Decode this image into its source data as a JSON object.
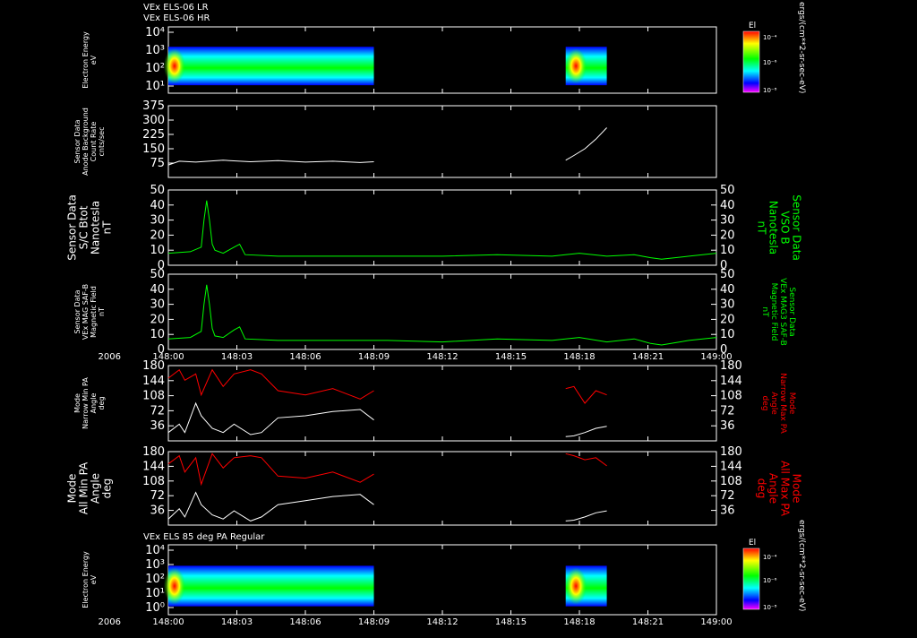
{
  "title_lines": [
    "VEx ELS-06 LR",
    "VEx ELS-06 HR"
  ],
  "bottom_panel_title": "VEx ELS 85 deg PA Regular",
  "year_label": "2006",
  "time_ticks": [
    "148:00",
    "148:03",
    "148:06",
    "148:09",
    "148:12",
    "148:15",
    "148:18",
    "148:21",
    "149:00"
  ],
  "colorbar": {
    "title": "El",
    "ticks": [
      "10⁻⁴",
      "10⁻⁶",
      "10⁻⁸"
    ],
    "units": "ergs/(cm**2-sr-sec-eV)"
  },
  "colors": {
    "white": "#ffffff",
    "green": "#00ff00",
    "red": "#ff0000",
    "black": "#000000"
  },
  "chart_data": [
    {
      "type": "heatmap",
      "id": "spectrogram-top",
      "ylabel": [
        "Electron Energy",
        "eV"
      ],
      "yticks": [
        "10⁴",
        "10³",
        "10²",
        "10¹"
      ],
      "scale": "log",
      "data_intervals": [
        [
          0.0,
          0.375
        ],
        [
          0.725,
          0.8
        ]
      ]
    },
    {
      "type": "line",
      "id": "count-rate",
      "ylabel": [
        "Sensor Data",
        "Anode Background",
        "Count Rate",
        "cnts/sec"
      ],
      "yticks": [
        "375",
        "300",
        "225",
        "150",
        "75"
      ],
      "ylim": [
        0,
        375
      ],
      "series": [
        {
          "color": "#ffffff",
          "x": [
            0.0,
            0.02,
            0.05,
            0.1,
            0.15,
            0.2,
            0.25,
            0.3,
            0.35,
            0.375
          ],
          "y": [
            65,
            85,
            80,
            90,
            82,
            88,
            80,
            85,
            78,
            82
          ]
        },
        {
          "color": "#ffffff",
          "x": [
            0.725,
            0.74,
            0.76,
            0.78,
            0.8
          ],
          "y": [
            90,
            115,
            150,
            200,
            260
          ]
        }
      ]
    },
    {
      "type": "line",
      "id": "bmag-vso",
      "ylabel": [
        "Sensor Data",
        "S/C Btot",
        "Nanotesla",
        "nT"
      ],
      "ylabel_right": [
        "Sensor Data",
        "VSO B",
        "Nanotesla",
        "nT"
      ],
      "yticks": [
        "50",
        "40",
        "30",
        "20",
        "10",
        "0"
      ],
      "ylim": [
        0,
        50
      ],
      "series": [
        {
          "color": "#00ff00",
          "x": [
            0.0,
            0.04,
            0.06,
            0.065,
            0.07,
            0.075,
            0.08,
            0.085,
            0.1,
            0.12,
            0.13,
            0.14,
            0.2,
            0.3,
            0.4,
            0.5,
            0.6,
            0.7,
            0.75,
            0.8,
            0.85,
            0.88,
            0.9,
            0.95,
            1.0
          ],
          "y": [
            8,
            9,
            12,
            30,
            43,
            30,
            14,
            10,
            8,
            12,
            14,
            7,
            6,
            6,
            6,
            6,
            7,
            6,
            8,
            6,
            7,
            5,
            4,
            6,
            8
          ]
        }
      ]
    },
    {
      "type": "line",
      "id": "mag-saf",
      "ylabel": [
        "Sensor Data",
        "VEx MAG SAF-B",
        "Magnetic Field",
        "nT"
      ],
      "ylabel_right": [
        "Sensor Data",
        "VEx MAG3 SAF-B",
        "Magnetic Field",
        "nT"
      ],
      "yticks": [
        "50",
        "40",
        "30",
        "20",
        "10",
        "0"
      ],
      "ylim": [
        0,
        50
      ],
      "series": [
        {
          "color": "#00ff00",
          "x": [
            0.0,
            0.04,
            0.06,
            0.065,
            0.07,
            0.075,
            0.08,
            0.085,
            0.1,
            0.12,
            0.13,
            0.14,
            0.2,
            0.3,
            0.4,
            0.5,
            0.6,
            0.7,
            0.75,
            0.8,
            0.85,
            0.88,
            0.9,
            0.95,
            1.0
          ],
          "y": [
            7,
            8,
            12,
            30,
            43,
            30,
            14,
            9,
            8,
            13,
            15,
            7,
            6,
            6,
            6,
            5,
            7,
            6,
            8,
            5,
            7,
            4,
            3,
            6,
            8
          ]
        }
      ]
    },
    {
      "type": "line",
      "id": "narrow-pa",
      "ylabel": [
        "Mode",
        "Narrow Min PA",
        "Angle",
        "deg"
      ],
      "ylabel_right": [
        "Mode",
        "Narrow Max PA",
        "Angle",
        "deg"
      ],
      "yticks": [
        "180",
        "144",
        "108",
        "72",
        "36"
      ],
      "ylim": [
        0,
        180
      ],
      "series": [
        {
          "color": "#ff0000",
          "x": [
            0.0,
            0.02,
            0.03,
            0.05,
            0.06,
            0.08,
            0.1,
            0.12,
            0.15,
            0.17,
            0.2,
            0.25,
            0.3,
            0.35,
            0.375
          ],
          "y": [
            150,
            170,
            145,
            160,
            110,
            170,
            130,
            160,
            170,
            160,
            120,
            110,
            125,
            100,
            120
          ]
        },
        {
          "color": "#ff0000",
          "x": [
            0.725,
            0.74,
            0.76,
            0.78,
            0.8
          ],
          "y": [
            125,
            130,
            90,
            120,
            110
          ]
        },
        {
          "color": "#ffffff",
          "x": [
            0.0,
            0.02,
            0.03,
            0.05,
            0.06,
            0.08,
            0.1,
            0.12,
            0.15,
            0.17,
            0.2,
            0.25,
            0.3,
            0.35,
            0.375
          ],
          "y": [
            20,
            40,
            20,
            90,
            60,
            30,
            20,
            40,
            15,
            20,
            55,
            60,
            70,
            75,
            50
          ]
        },
        {
          "color": "#ffffff",
          "x": [
            0.725,
            0.74,
            0.76,
            0.78,
            0.8
          ],
          "y": [
            10,
            12,
            20,
            30,
            35
          ]
        }
      ]
    },
    {
      "type": "line",
      "id": "all-pa",
      "ylabel": [
        "Mode",
        "All Min PA",
        "Angle",
        "deg"
      ],
      "ylabel_right": [
        "Mode",
        "All Max PA",
        "Angle",
        "deg"
      ],
      "yticks": [
        "180",
        "144",
        "108",
        "72",
        "36"
      ],
      "ylim": [
        0,
        180
      ],
      "series": [
        {
          "color": "#ff0000",
          "x": [
            0.0,
            0.02,
            0.03,
            0.05,
            0.06,
            0.08,
            0.1,
            0.12,
            0.15,
            0.17,
            0.2,
            0.25,
            0.3,
            0.35,
            0.375
          ],
          "y": [
            150,
            170,
            130,
            165,
            100,
            175,
            140,
            165,
            170,
            165,
            120,
            115,
            130,
            105,
            125
          ]
        },
        {
          "color": "#ff0000",
          "x": [
            0.725,
            0.74,
            0.76,
            0.78,
            0.8
          ],
          "y": [
            175,
            170,
            160,
            165,
            145
          ]
        },
        {
          "color": "#ffffff",
          "x": [
            0.0,
            0.02,
            0.03,
            0.05,
            0.06,
            0.08,
            0.1,
            0.12,
            0.15,
            0.17,
            0.2,
            0.25,
            0.3,
            0.35,
            0.375
          ],
          "y": [
            15,
            40,
            20,
            80,
            50,
            25,
            15,
            35,
            10,
            20,
            50,
            60,
            70,
            75,
            50
          ]
        },
        {
          "color": "#ffffff",
          "x": [
            0.725,
            0.74,
            0.76,
            0.78,
            0.8
          ],
          "y": [
            10,
            12,
            20,
            30,
            35
          ]
        }
      ]
    },
    {
      "type": "heatmap",
      "id": "spectrogram-bottom",
      "ylabel": [
        "Electron Energy",
        "eV"
      ],
      "yticks": [
        "10⁴",
        "10³",
        "10²",
        "10¹",
        "10⁰"
      ],
      "scale": "log",
      "data_intervals": [
        [
          0.0,
          0.375
        ],
        [
          0.725,
          0.8
        ]
      ]
    }
  ]
}
